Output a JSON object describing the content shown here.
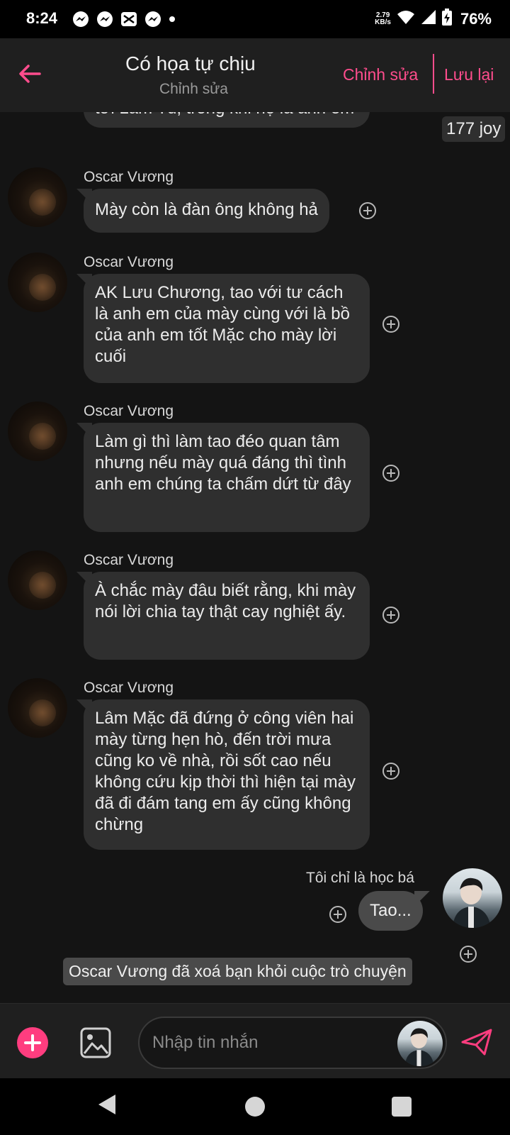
{
  "status_bar": {
    "time": "8:24",
    "net_speed_value": "2.79",
    "net_speed_unit": "KB/s",
    "battery": "76%",
    "notification_icons": [
      "messenger-icon",
      "messenger-icon",
      "capcut-icon",
      "messenger-icon",
      "dot-icon"
    ]
  },
  "header": {
    "title": "Có họa tự chịu",
    "subtitle": "Chỉnh sửa",
    "edit_label": "Chỉnh sửa",
    "save_label": "Lưu lại"
  },
  "messages": [
    {
      "sender": "",
      "text": "tới Lâm Tú, trong khi họ là anh em"
    },
    {
      "sender": "Oscar Vương",
      "text": "Mày còn là đàn ông không hả"
    },
    {
      "sender": "Oscar Vương",
      "text": "AK Lưu Chương, tao với tư cách là anh em của mày cùng với là bồ của anh em tốt Mặc cho mày lời cuối"
    },
    {
      "sender": "Oscar Vương",
      "text": "Làm gì thì làm tao đéo quan tâm nhưng nếu mày quá đáng thì tình anh em chúng ta chấm dứt từ đây"
    },
    {
      "sender": "Oscar Vương",
      "text": "À chắc mày đâu biết rằng, khi mày nói lời chia tay thật cay nghiệt ấy."
    },
    {
      "sender": "Oscar Vương",
      "text": "Lâm Mặc đã đứng ở công viên hai mày từng hẹn hò, đến trời mưa cũng ko về nhà, rồi sốt cao nếu không cứu kịp thời thì hiện tại mày đã đi đám tang em ấy cũng không chừng"
    }
  ],
  "joy_badge": "177 joy",
  "my_message": {
    "sender": "Tôi chỉ là học bá",
    "text": "Tao..."
  },
  "system_notice": "Oscar Vương đã xoá bạn khỏi cuộc trò chuyện",
  "composer": {
    "placeholder": "Nhập tin nhắn"
  },
  "colors": {
    "accent": "#ff4d8d",
    "plus_button": "#ff3d7f",
    "bubble": "#2f2f2f",
    "my_bubble": "#4a4a4a",
    "header_bg": "#1f1f1f",
    "chat_bg": "#141414"
  }
}
